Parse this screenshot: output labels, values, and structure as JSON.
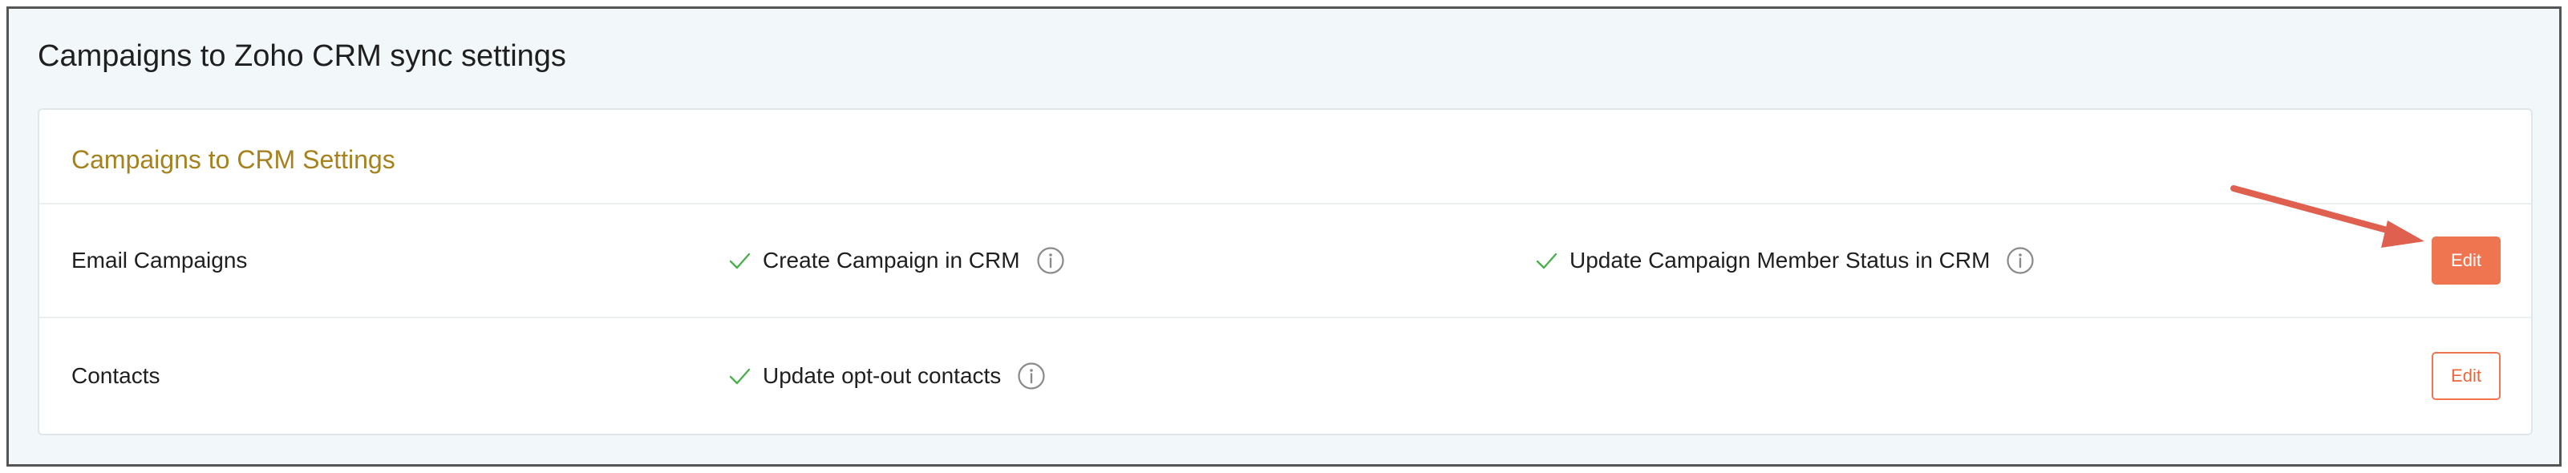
{
  "page": {
    "title": "Campaigns to Zoho CRM sync settings"
  },
  "panel": {
    "section_title": "Campaigns to CRM Settings",
    "rows": [
      {
        "label": "Email Campaigns",
        "options": [
          {
            "text": "Create Campaign in CRM",
            "checked": true,
            "icon": "info-icon"
          },
          {
            "text": "Update Campaign Member Status in CRM",
            "checked": true,
            "icon": "info-icon"
          }
        ],
        "edit_label": "Edit",
        "edit_style": "filled"
      },
      {
        "label": "Contacts",
        "options": [
          {
            "text": "Update opt-out contacts",
            "checked": true,
            "icon": "info-icon"
          }
        ],
        "edit_label": "Edit",
        "edit_style": "outline"
      }
    ]
  },
  "colors": {
    "accent": "#ef7450",
    "section_title": "#a5821e",
    "check": "#4caf50",
    "annotation_arrow": "#e06050"
  }
}
